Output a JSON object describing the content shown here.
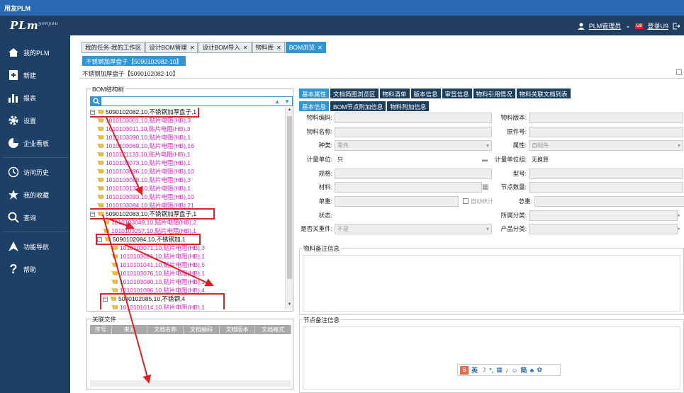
{
  "window": {
    "title": "用友PLM"
  },
  "header": {
    "logo": "PLm",
    "logo_sup": "yonyou",
    "user_label": "PLM管理员",
    "u9_badge": "U8",
    "login_label": "登录U9"
  },
  "sidebar": {
    "items": [
      {
        "label": "我的PLM",
        "icon": "home-icon"
      },
      {
        "label": "新建",
        "icon": "new-document-icon"
      },
      {
        "label": "报表",
        "icon": "bar-chart-icon"
      },
      {
        "label": "设置",
        "icon": "gear-icon"
      },
      {
        "label": "企业看板",
        "icon": "dashboard-icon"
      },
      {
        "label": "访问历史",
        "icon": "history-icon"
      },
      {
        "label": "我的收藏",
        "icon": "star-icon"
      },
      {
        "label": "查询",
        "icon": "search-icon"
      },
      {
        "label": "功能导航",
        "icon": "navigation-icon"
      },
      {
        "label": "帮助",
        "icon": "help-icon"
      }
    ]
  },
  "tabs": [
    {
      "label": "我的任务-我的工作区",
      "closable": false,
      "active": false
    },
    {
      "label": "设计BOM管理",
      "closable": true,
      "active": false
    },
    {
      "label": "设计BOM导入",
      "closable": true,
      "active": false
    },
    {
      "label": "物料库",
      "closable": true,
      "active": false
    },
    {
      "label": "BOM浏览",
      "closable": true,
      "active": true
    }
  ],
  "subtab": {
    "label": "不锈钢加厚盘子【5090102082-10】"
  },
  "page_title": "不锈钢加厚盘子【5090102082-10】",
  "tree": {
    "title": "BOM结构树",
    "search_placeholder": "",
    "nodes": [
      {
        "text": "5090102082,10,不锈钢加厚盘子,1",
        "type": "parent"
      },
      {
        "text": "1010103001,10,贴片电阻(HB),3",
        "type": "leaf"
      },
      {
        "text": "1010103011,10,贴片电阻(HB),3",
        "type": "leaf"
      },
      {
        "text": "1010103090,10,贴片电阻(HB),1",
        "type": "leaf"
      },
      {
        "text": "1010103069,10,贴片电阻(HB),16",
        "type": "leaf"
      },
      {
        "text": "1010121133,10,贴片电阻(HB),1",
        "type": "leaf"
      },
      {
        "text": "1010103073,10,贴片电阻(HB),1",
        "type": "leaf"
      },
      {
        "text": "1010103096,10,贴片电阻(HB),10",
        "type": "leaf"
      },
      {
        "text": "1010103088,10,贴片电阻(HB),3",
        "type": "leaf"
      },
      {
        "text": "1010103137,10,贴片电阻(HB),1",
        "type": "leaf"
      },
      {
        "text": "1010103093,10,贴片电阻(HB),10",
        "type": "leaf"
      },
      {
        "text": "1010103084,10,贴片电阻(HB),21",
        "type": "leaf"
      },
      {
        "text": "5090102083,10,不锈钢加厚盘子,1",
        "type": "parent"
      },
      {
        "text": "1010103049,10,贴片电阻(HB),2",
        "type": "leaf"
      },
      {
        "text": "1010103257,10,贴片电阻(HB),1",
        "type": "leaf"
      },
      {
        "text": "5090102084,10,不锈钢加,1",
        "type": "parent"
      },
      {
        "text": "1010103071,10,贴片电阻(HB),3",
        "type": "leaf"
      },
      {
        "text": "1010103081,10,贴片电阻(HB),1",
        "type": "leaf"
      },
      {
        "text": "1010101041,10,贴片电阻(HB),5",
        "type": "leaf"
      },
      {
        "text": "1010103076,10,贴片电阻(HB),1",
        "type": "leaf"
      },
      {
        "text": "1010103080,10,贴片电阻(HB),1",
        "type": "leaf"
      },
      {
        "text": "1010101086,10,贴片电阻(HB),4",
        "type": "leaf"
      },
      {
        "text": "5090102085,10,不锈钢,4",
        "type": "parent"
      },
      {
        "text": "1010101014,10,贴片电阻(HB),1",
        "type": "leaf"
      }
    ]
  },
  "files": {
    "title": "关联文件",
    "columns": [
      "序号",
      "来源",
      "文档名称",
      "文档编码",
      "文档版本",
      "文档格式"
    ]
  },
  "right_tabs": [
    "基本属性",
    "文档简图浏览区",
    "物料清单",
    "版本信息",
    "审签信息",
    "物料引用情况",
    "物料关联文档列表"
  ],
  "right_subtabs": [
    "基本信息",
    "BOM节点附加信息",
    "物料附加信息"
  ],
  "form": {
    "item_code": {
      "label": "物料编码:",
      "value": ""
    },
    "item_version": {
      "label": "物料版本:",
      "value": ""
    },
    "item_name": {
      "label": "物料名称:",
      "value": ""
    },
    "original_part_no": {
      "label": "原件号:",
      "value": ""
    },
    "category": {
      "label": "种类:",
      "value": "零件"
    },
    "attribute": {
      "label": "属性:",
      "value": "自制件"
    },
    "unit": {
      "label": "计量单位:",
      "value": "只"
    },
    "unit_group": {
      "label": "计量单位组:",
      "value": "无换算"
    },
    "spec": {
      "label": "规格:",
      "value": ""
    },
    "model": {
      "label": "型号:",
      "value": ""
    },
    "material": {
      "label": "材料:",
      "value": ""
    },
    "node_qty": {
      "label": "节点数量:",
      "value": ""
    },
    "unit_weight": {
      "label": "单重:",
      "value": ""
    },
    "auto_calc": {
      "label": "自动统计"
    },
    "total_weight": {
      "label": "总重:",
      "value": ""
    },
    "status": {
      "label": "状态:",
      "value": ""
    },
    "classification": {
      "label": "所属分类:",
      "value": ""
    },
    "is_key_part": {
      "label": "是否关重件:",
      "value": "不是"
    },
    "product_class": {
      "label": "产品分类:",
      "value": ""
    }
  },
  "notes": {
    "item_notes_title": "物料备注信息",
    "node_notes_title": "节点备注信息"
  },
  "ime": {
    "label": "英"
  },
  "colors": {
    "sidebar": "#1e4066",
    "accent": "#2e95d6",
    "leaf_text": "#e020c0",
    "highlight": "#e02020"
  }
}
